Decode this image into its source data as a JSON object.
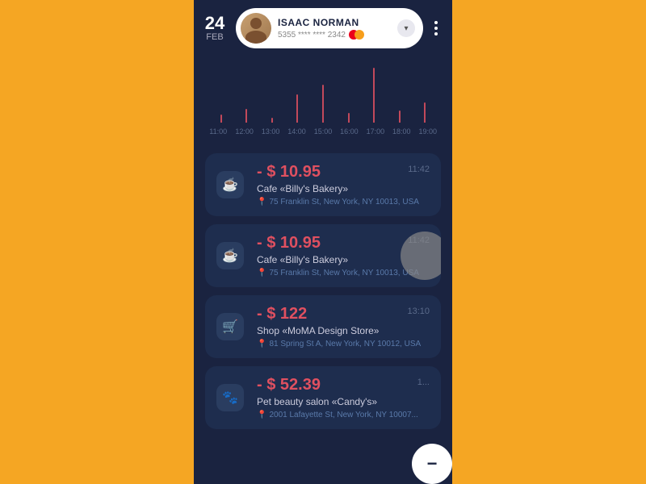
{
  "date": {
    "day": "24",
    "month": "FEB"
  },
  "profile": {
    "name": "ISAAC NORMAN",
    "card_number": "5355 **** **** 2342",
    "chevron": "▾"
  },
  "chart": {
    "labels": [
      "11:00",
      "12:00",
      "13:00",
      "14:00",
      "15:00",
      "16:00",
      "17:00",
      "18:00",
      "19:00"
    ],
    "bars": [
      8,
      14,
      5,
      28,
      38,
      10,
      55,
      12,
      20
    ]
  },
  "transactions": [
    {
      "icon": "☕",
      "amount": "- $ 10.95",
      "name": "Cafe «Billy's Bakery»",
      "time": "11:42",
      "location": "75 Franklin St, New York, NY 10013, USA",
      "swiped": false
    },
    {
      "icon": "☕",
      "amount": "- $ 10.95",
      "name": "Cafe «Billy's Bakery»",
      "time": "11:42",
      "location": "75 Franklin St, New York, NY 10013, USA",
      "swiped": true
    },
    {
      "icon": "🛍",
      "amount": "- $ 122",
      "name": "Shop «MoMA Design Store»",
      "time": "13:10",
      "location": "81 Spring St A, New York, NY 10012, USA",
      "swiped": false
    },
    {
      "icon": "🐾",
      "amount": "- $ 52.39",
      "name": "Pet beauty salon «Candy's»",
      "time": "1...",
      "location": "2001 Lafayette St, New York, NY 10007...",
      "swiped": false
    }
  ],
  "more_button_label": "⋮",
  "pin_icon": "📍"
}
